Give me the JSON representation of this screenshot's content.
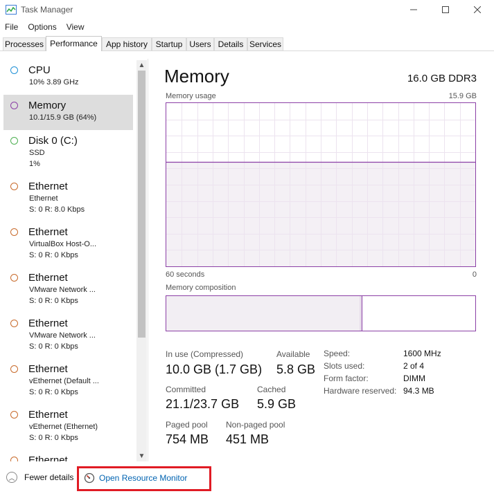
{
  "window": {
    "title": "Task Manager"
  },
  "menu": [
    "File",
    "Options",
    "View"
  ],
  "tabs": [
    "Processes",
    "Performance",
    "App history",
    "Startup",
    "Users",
    "Details",
    "Services"
  ],
  "active_tab": "Performance",
  "sidebar": [
    {
      "name": "CPU",
      "sub1": "10%  3.89 GHz",
      "sub2": "",
      "color": "#1e90d6"
    },
    {
      "name": "Memory",
      "sub1": "10.1/15.9 GB (64%)",
      "sub2": "",
      "color": "#8b3fa6",
      "selected": true
    },
    {
      "name": "Disk 0 (C:)",
      "sub1": "SSD",
      "sub2": "1%",
      "color": "#4caf50"
    },
    {
      "name": "Ethernet",
      "sub1": "Ethernet",
      "sub2": "S: 0 R: 8.0 Kbps",
      "color": "#c86a2b"
    },
    {
      "name": "Ethernet",
      "sub1": "VirtualBox Host-O...",
      "sub2": "S: 0 R: 0 Kbps",
      "color": "#c86a2b"
    },
    {
      "name": "Ethernet",
      "sub1": "VMware Network ...",
      "sub2": "S: 0 R: 0 Kbps",
      "color": "#c86a2b"
    },
    {
      "name": "Ethernet",
      "sub1": "VMware Network ...",
      "sub2": "S: 0 R: 0 Kbps",
      "color": "#c86a2b"
    },
    {
      "name": "Ethernet",
      "sub1": "vEthernet (Default ...",
      "sub2": "S: 0 R: 0 Kbps",
      "color": "#c86a2b"
    },
    {
      "name": "Ethernet",
      "sub1": "vEthernet (Ethernet)",
      "sub2": "S: 0 R: 0 Kbps",
      "color": "#c86a2b"
    },
    {
      "name": "Ethernet",
      "sub1": "",
      "sub2": "",
      "color": "#c86a2b"
    }
  ],
  "main": {
    "title": "Memory",
    "spec": "16.0 GB DDR3",
    "usage_label": "Memory usage",
    "usage_max": "15.9 GB",
    "time_left": "60 seconds",
    "time_right": "0",
    "usage_fraction": 0.64,
    "composition_label": "Memory composition",
    "composition_in_use_fraction": 0.635,
    "stats": {
      "in_use_label": "In use (Compressed)",
      "in_use": "10.0 GB (1.7 GB)",
      "available_label": "Available",
      "available": "5.8 GB",
      "committed_label": "Committed",
      "committed": "21.1/23.7 GB",
      "cached_label": "Cached",
      "cached": "5.9 GB",
      "paged_label": "Paged pool",
      "paged": "754 MB",
      "nonpaged_label": "Non-paged pool",
      "nonpaged": "451 MB"
    },
    "specs": [
      {
        "label": "Speed:",
        "value": "1600 MHz"
      },
      {
        "label": "Slots used:",
        "value": "2 of 4"
      },
      {
        "label": "Form factor:",
        "value": "DIMM"
      },
      {
        "label": "Hardware reserved:",
        "value": "94.3 MB"
      }
    ]
  },
  "footer": {
    "fewer_details": "Fewer details",
    "open_resource_monitor": "Open Resource Monitor"
  },
  "colors": {
    "accent_memory": "#8b3fa6",
    "highlight_box": "#e01b24",
    "link": "#0063b1"
  }
}
